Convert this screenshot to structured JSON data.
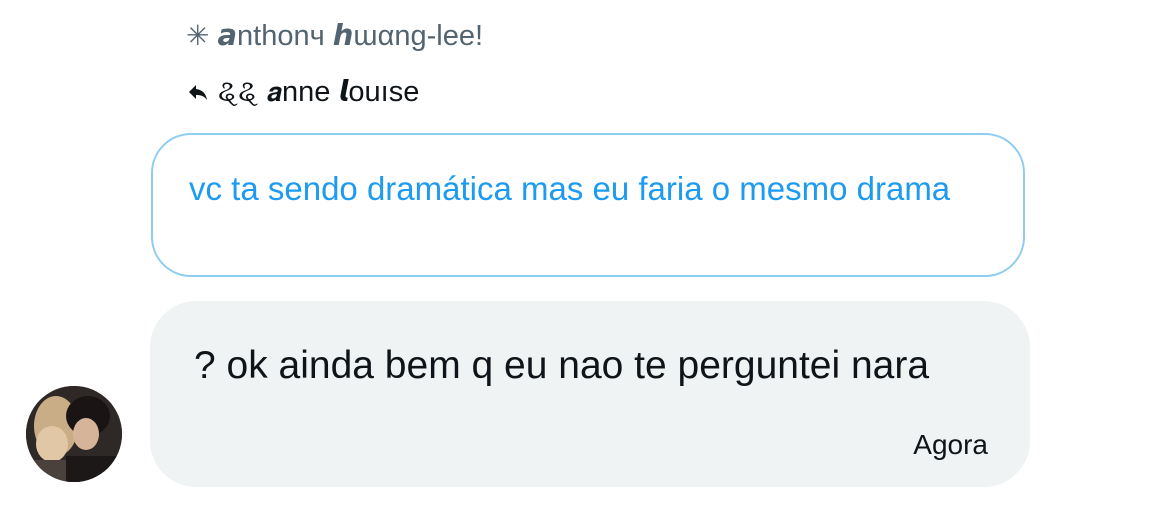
{
  "header": {
    "sender_name": "𝙖nthonч 𝙝ɯαng-lee!"
  },
  "reply_context": {
    "replying_to_name": "ୡୡ 𝙖nne 𝙡ouıse"
  },
  "quoted_message": {
    "text": "vc ta sendo dramática mas eu faria o mesmo drama"
  },
  "message": {
    "text": "? ok ainda bem q eu nao te perguntei nara",
    "timestamp": "Agora"
  },
  "colors": {
    "accent": "#1d9bf0",
    "bubble_bg": "#eff3f4",
    "quoted_border": "#8ecdf0",
    "secondary_text": "#536471"
  }
}
